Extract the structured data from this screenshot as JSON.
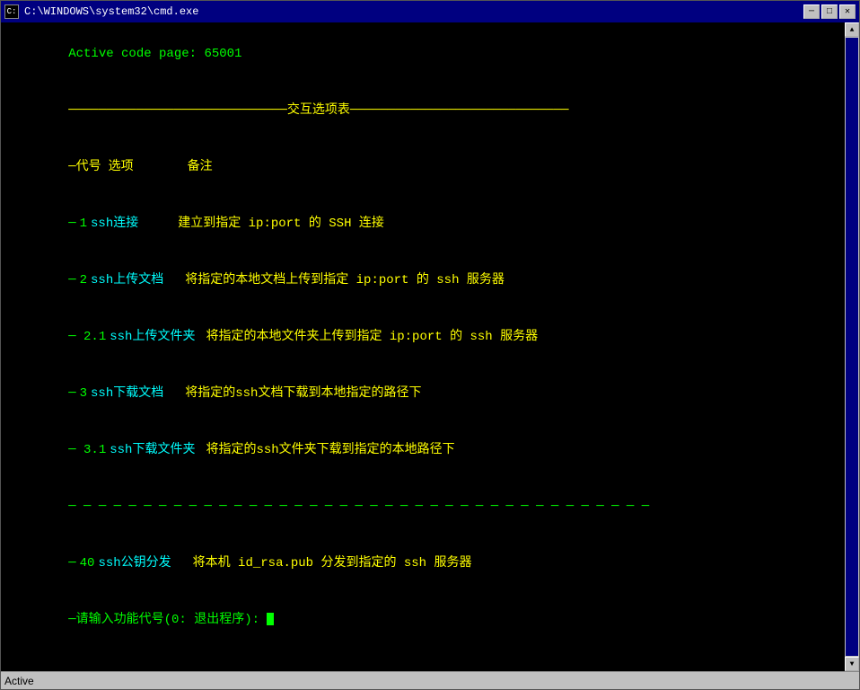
{
  "window": {
    "title": "C:\\WINDOWS\\system32\\cmd.exe",
    "icon": "C:"
  },
  "titlebar": {
    "minimize": "─",
    "maximize": "□",
    "close": "✕"
  },
  "terminal": {
    "active_code": "Active code page: 65001",
    "menu_header": "─────────────────────────────交互选项表─────────────────────────────",
    "header_col1": "─代号",
    "header_col2": "选项",
    "header_col3": "备注",
    "items": [
      {
        "dash": "─",
        "code": "1",
        "name": "ssh连接",
        "desc": "建立到指定 ip:port 的 SSH 连接"
      },
      {
        "dash": "─",
        "code": "2",
        "name": "ssh上传文档",
        "desc": "将指定的本地文档上传到指定 ip:port 的 ssh 服务器"
      },
      {
        "dash": "─",
        "code": "2.1",
        "name": "ssh上传文件夹",
        "desc": "将指定的本地文件夹上传到指定 ip:port 的 ssh 服务器"
      },
      {
        "dash": "─",
        "code": "3",
        "name": "ssh下载文档",
        "desc": "将指定的ssh文档下载到本地指定的路径下"
      },
      {
        "dash": "─",
        "code": "3.1",
        "name": "ssh下载文件夹",
        "desc": "将指定的ssh文件夹下载到指定的本地路径下"
      }
    ],
    "separator": "─ ─ ─ ─ ─ ─ ─ ─ ─ ─ ─ ─ ─ ─ ─ ─ ─ ─ ─ ─ ─ ─ ─ ─ ─ ─ ─ ─ ─ ─ ─ ─ ─ ─ ─ ─ ─ ─ ─",
    "extra_item": {
      "dash": "─",
      "code": "40",
      "name": "ssh公钥分发",
      "desc": "将本机 id_rsa.pub 分发到指定的 ssh 服务器"
    },
    "prompt": "─请输入功能代号(0: 退出程序): "
  },
  "status": {
    "text": "Active"
  }
}
